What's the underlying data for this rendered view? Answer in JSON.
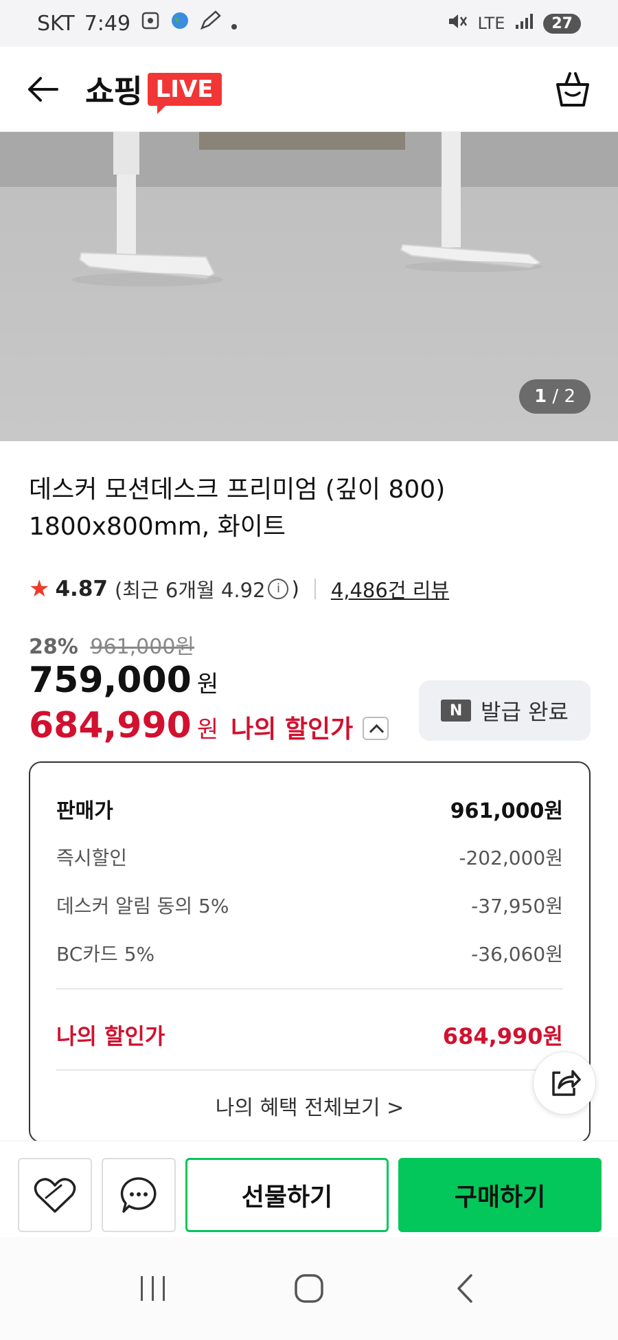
{
  "status_bar": {
    "carrier": "SKT",
    "time": "7:49",
    "network": "LTE",
    "battery": "27"
  },
  "header": {
    "logo_text": "쇼핑",
    "logo_badge": "LIVE"
  },
  "gallery": {
    "current": "1",
    "total": "/ 2"
  },
  "product": {
    "title_line1": "데스커 모션데스크 프리미엄 (깊이 800)",
    "title_line2": "1800x800mm, 화이트",
    "rating": "4.87",
    "recent_rating": "(최근 6개월 4.92",
    "recent_rating_close": ")",
    "review_count": "4,486건 리뷰"
  },
  "price": {
    "discount_pct": "28%",
    "original": "961,000원",
    "sale": "759,000",
    "won": "원",
    "my_price": "684,990",
    "my_price_label": "나의 할인가"
  },
  "coupon": {
    "badge": "N",
    "label": "발급 완료"
  },
  "breakdown": {
    "rows": [
      {
        "label": "판매가",
        "value": "961,000원"
      },
      {
        "label": "즉시할인",
        "value": "-202,000원"
      },
      {
        "label": "데스커 알림 동의 5%",
        "value": "-37,950원"
      },
      {
        "label": "BC카드 5%",
        "value": "-36,060원"
      }
    ],
    "total_label": "나의 할인가",
    "total_value": "684,990원",
    "see_all": "나의 혜택 전체보기 >"
  },
  "actions": {
    "gift": "선물하기",
    "buy": "구매하기"
  },
  "colors": {
    "accent_green": "#03c75a",
    "price_red": "#d1112f",
    "live_red": "#f23636"
  }
}
